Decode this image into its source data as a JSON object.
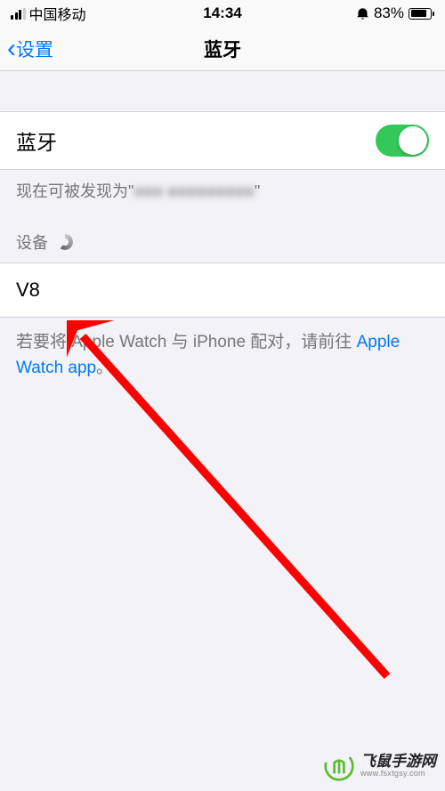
{
  "statusBar": {
    "carrier": "中国移动",
    "time": "14:34",
    "alarmIcon": "⏰",
    "batteryPercent": "83%",
    "batteryFill": 83
  },
  "nav": {
    "backLabel": "设置",
    "title": "蓝牙"
  },
  "bluetooth": {
    "label": "蓝牙",
    "enabled": true
  },
  "discoverable": {
    "prefix": "现在可被发现为\"",
    "deviceName": "■■■ ■■■■■■■■■",
    "suffix": "\""
  },
  "devices": {
    "header": "设备",
    "list": [
      {
        "name": "V8"
      }
    ]
  },
  "helpText": {
    "part1": "若要将 Apple Watch 与 iPhone 配对，请前往 ",
    "linkText": "Apple Watch app",
    "part2": "。"
  },
  "watermark": {
    "main": "飞鼠手游网",
    "sub": "www.fsxtgsy.com"
  },
  "annotation": {
    "type": "arrow",
    "color": "#ff0000"
  }
}
